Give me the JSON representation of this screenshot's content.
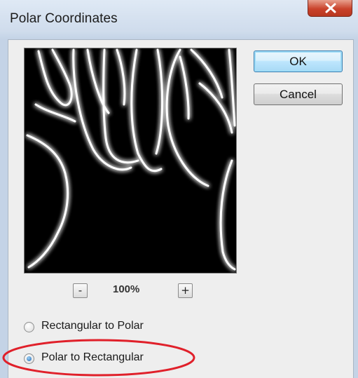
{
  "window": {
    "title": "Polar Coordinates"
  },
  "buttons": {
    "ok": "OK",
    "cancel": "Cancel"
  },
  "zoom": {
    "minus": "-",
    "plus": "+",
    "value": "100%"
  },
  "options": [
    {
      "label": "Rectangular to Polar",
      "checked": false
    },
    {
      "label": "Polar to Rectangular",
      "checked": true
    }
  ],
  "icons": {
    "close": "close-icon",
    "minus": "minus-icon",
    "plus": "plus-icon"
  },
  "colors": {
    "title_bar": "#cfdcec",
    "close_button": "#c9422b",
    "annotation": "#e0202a",
    "radio_selected": "#1d67b5"
  }
}
